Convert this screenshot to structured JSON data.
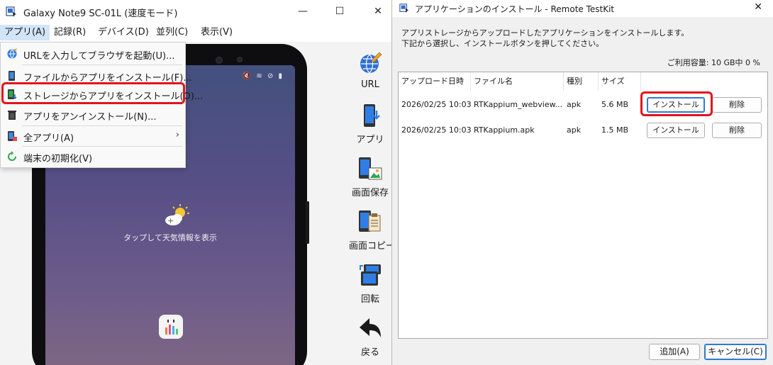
{
  "main_window": {
    "title": "Galaxy Note9 SC-01L (速度モード)",
    "controls": {
      "minimize": "—",
      "maximize": "☐",
      "close": "✕"
    },
    "menu": [
      "アプリ(A)",
      "記録(R)",
      "デバイス(D)",
      "並列(C)",
      "表示(V)"
    ],
    "dropdown": [
      {
        "label": "URLを入力してブラウザを起動(U)...",
        "icon": "browser-icon"
      },
      {
        "label": "ファイルからアプリをインストール(F)...",
        "icon": "phone-file-icon"
      },
      {
        "label": "ストレージからアプリをインストール(O)...",
        "icon": "storage-install-icon"
      },
      {
        "label": "アプリをアンインストール(N)...",
        "icon": "trash-icon"
      },
      {
        "label": "全アプリ(A)",
        "icon": "all-apps-icon",
        "submenu_arrow": "›"
      },
      {
        "label": "端末の初期化(V)",
        "icon": "reset-icon"
      }
    ],
    "phone_screen": {
      "weather_text": "タップして天気情報を表示",
      "status_icons": "🔇 ≋ ⊘ ▮"
    },
    "toolbar": [
      "URL",
      "アプリ",
      "画面保存",
      "画面コピー",
      "回転",
      "戻る"
    ],
    "highlight_color": "#e3141c"
  },
  "dialog": {
    "title": "アプリケーションのインストール - Remote TestKit",
    "close": "✕",
    "description_lines": [
      "アプリストレージからアップロードしたアプリケーションをインストールします。",
      "下記から選択し、インストールボタンを押してください。"
    ],
    "capacity": "ご利用容量: 10 GB中 0 %",
    "columns": [
      "アップロード日時",
      "ファイル名",
      "種別",
      "サイズ",
      ""
    ],
    "rows": [
      {
        "date": "2026/02/25 10:03",
        "file": "RTKappium_webview....",
        "type": "apk",
        "size": "5.6 MB",
        "install": "インストール",
        "delete": "削除"
      },
      {
        "date": "2026/02/25 10:03",
        "file": "RTKappium.apk",
        "type": "apk",
        "size": "1.5 MB",
        "install": "インストール",
        "delete": "削除"
      }
    ],
    "add_button": "追加(A)",
    "cancel_button": "キャンセル(C)"
  }
}
